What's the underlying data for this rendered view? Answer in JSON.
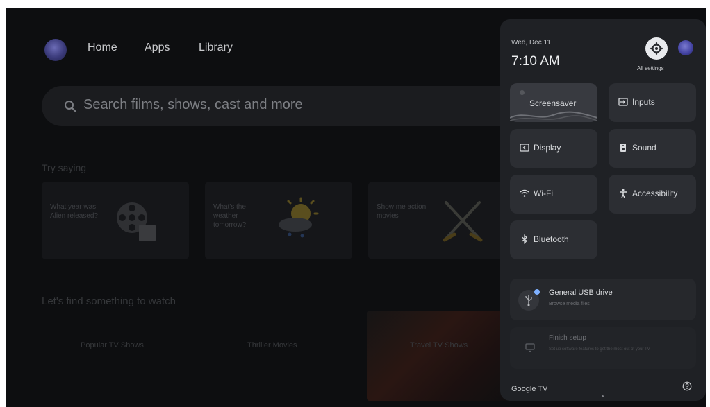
{
  "nav": {
    "home": "Home",
    "apps": "Apps",
    "library": "Library"
  },
  "search": {
    "placeholder": "Search films, shows, cast and more"
  },
  "try_saying": {
    "title": "Try saying",
    "cards": [
      {
        "text": "What year was Alien released?",
        "icon": "film-reel-icon"
      },
      {
        "text": "What's the weather tomorrow?",
        "icon": "weather-icon"
      },
      {
        "text": "Show me action movies",
        "icon": "crossed-swords-icon"
      }
    ]
  },
  "find_section": {
    "title": "Let's find something to watch",
    "shelves": [
      "Popular TV Shows",
      "Thriller Movies",
      "Travel TV Shows"
    ]
  },
  "quick_settings": {
    "date": "Wed, Dec 11",
    "time": "7:10 AM",
    "all_settings_label": "All settings",
    "tiles": [
      {
        "label": "Screensaver",
        "icon": "screensaver-icon"
      },
      {
        "label": "Inputs",
        "icon": "inputs-icon"
      },
      {
        "label": "Display",
        "icon": "display-icon"
      },
      {
        "label": "Sound",
        "icon": "speaker-icon"
      },
      {
        "label": "Wi-Fi",
        "icon": "wifi-icon"
      },
      {
        "label": "Accessibility",
        "icon": "accessibility-icon"
      },
      {
        "label": "Bluetooth",
        "icon": "bluetooth-icon"
      }
    ],
    "usb": {
      "title": "General USB drive",
      "subtitle": "Browse media files"
    },
    "finish_setup": {
      "title": "Finish setup",
      "subtitle": "Set up software features to get the most out of your TV"
    },
    "footer_brand": "Google TV"
  },
  "colors": {
    "panel_bg": "#1f2125",
    "tile_bg": "#2c2e33",
    "accent_blue": "#7fb1ff"
  }
}
